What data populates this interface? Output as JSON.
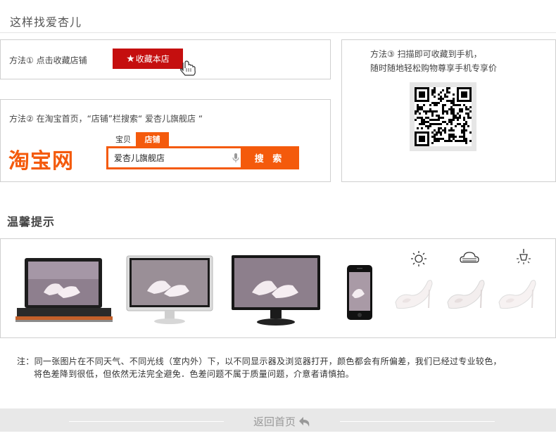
{
  "page": {
    "title": "这样找爱杏儿"
  },
  "method1": {
    "label": "方法① 点击收藏店铺",
    "button_label": "收藏本店",
    "star_icon": "star-icon",
    "cursor_icon": "hand-cursor-icon"
  },
  "method2": {
    "label": "方法② 在淘宝首页，“店铺”栏搜索“ 爱杏儿旗舰店 “",
    "logo_text": "淘宝网",
    "tabs": [
      "宝贝",
      "店铺"
    ],
    "active_tab": "店铺",
    "search_value": "爱杏儿旗舰店",
    "search_button": "搜 索",
    "accent_color": "#f45a0c"
  },
  "method3": {
    "line1": "方法③ 扫描即可收藏到手机，",
    "line2": "随时随地轻松购物尊享手机专享价"
  },
  "tips": {
    "title": "温馨提示",
    "device_icons": [
      "laptop-icon",
      "monitor-icon",
      "tv-monitor-icon",
      "phone-icon"
    ],
    "weather_icons": [
      "sun-icon",
      "cloud-icon",
      "lamp-icon"
    ]
  },
  "note": {
    "line1": "注：同一张图片在不同天气、不同光线（室内外）下，以不同显示器及浏览器打开，颜色都会有所偏差，我们已经过专业较色，",
    "line2": "将色差降到很低，但依然无法完全避免．色差问题不属于质量问题，介意者请慎拍。"
  },
  "footer": {
    "back_label": "返回首页",
    "back_icon": "return-arrow-icon"
  }
}
